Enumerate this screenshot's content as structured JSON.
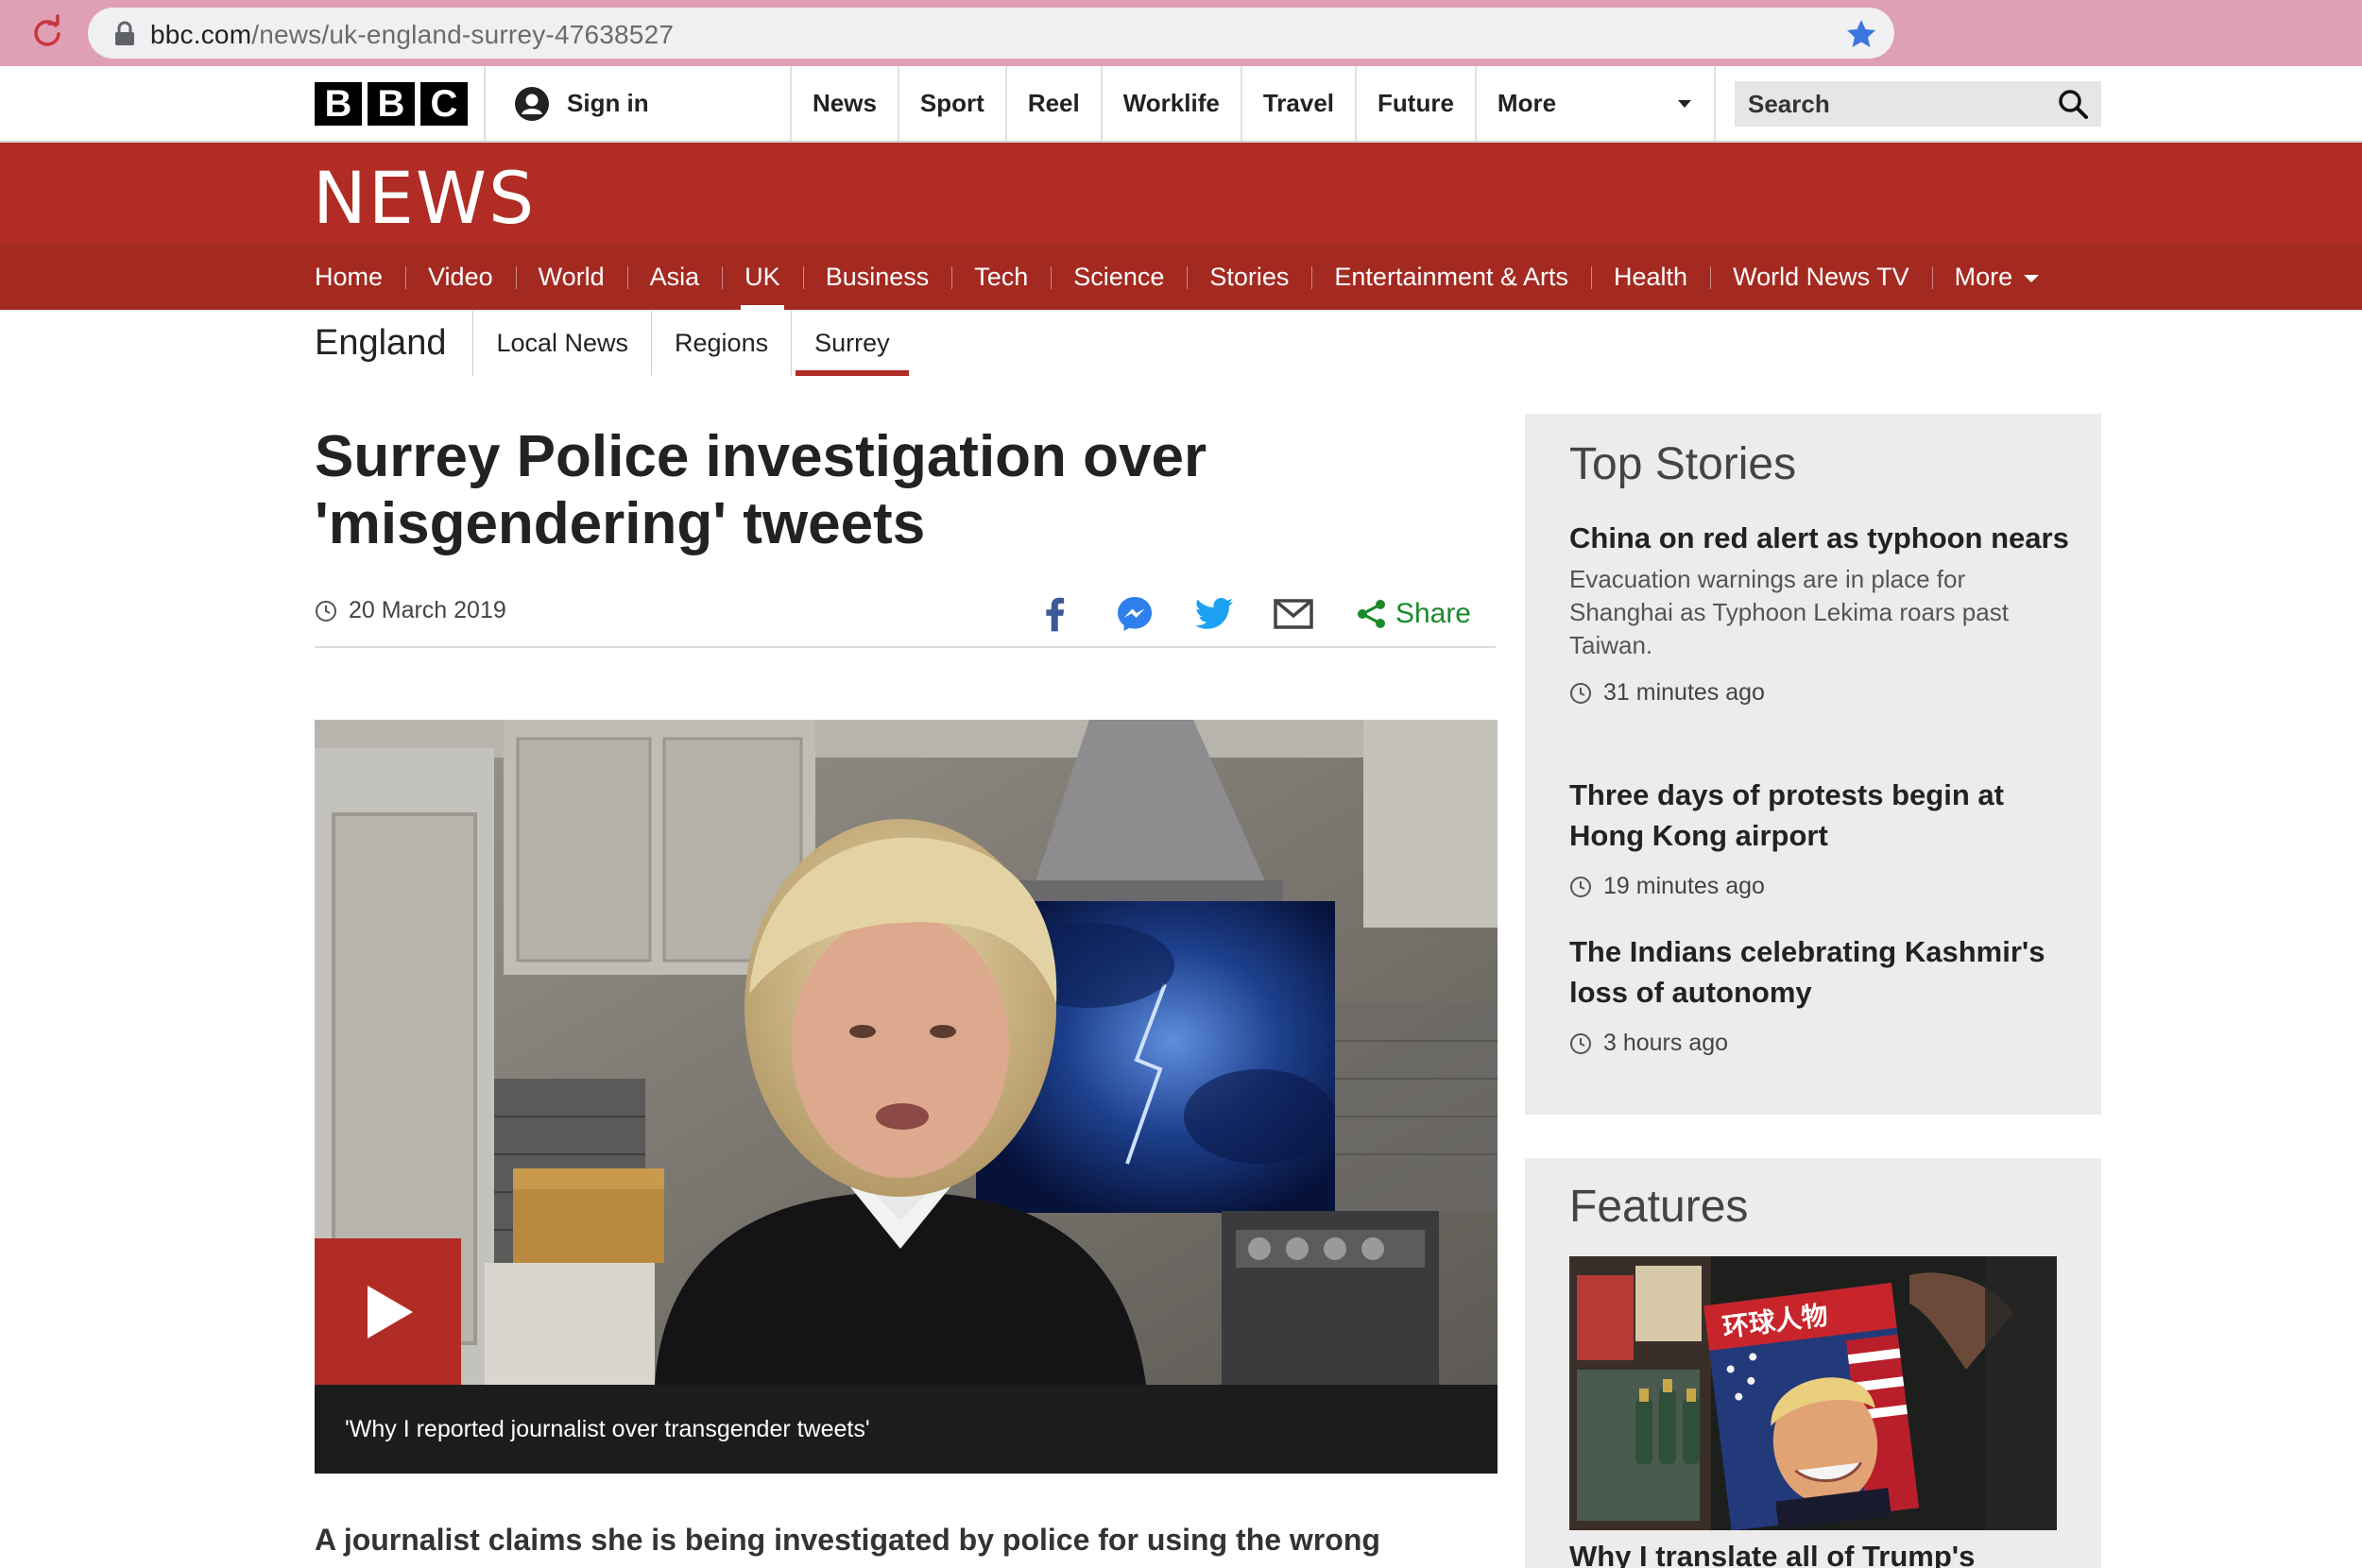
{
  "browser": {
    "url_host": "bbc.com",
    "url_path": "/news/uk-england-surrey-47638527"
  },
  "bbc_bar": {
    "logo_letters": [
      "B",
      "B",
      "C"
    ],
    "sign_in": "Sign in",
    "nav": [
      "News",
      "Sport",
      "Reel",
      "Worklife",
      "Travel",
      "Future"
    ],
    "more": "More",
    "search_placeholder": "Search"
  },
  "news_header": {
    "brand": "NEWS",
    "sections": [
      "Home",
      "Video",
      "World",
      "Asia",
      "UK",
      "Business",
      "Tech",
      "Science",
      "Stories",
      "Entertainment & Arts",
      "Health",
      "World News TV"
    ],
    "active_section": "UK",
    "more": "More"
  },
  "sub_nav": {
    "region": "England",
    "items": [
      "Local News",
      "Regions",
      "Surrey"
    ],
    "active": "Surrey"
  },
  "article": {
    "headline": "Surrey Police investigation over 'misgendering' tweets",
    "date": "20 March 2019",
    "share_label": "Share",
    "share_icons": [
      "facebook-icon",
      "messenger-icon",
      "twitter-icon",
      "email-icon",
      "share-icon"
    ],
    "video_caption": "'Why I reported journalist over transgender tweets'",
    "lede": "A journalist claims she is being investigated by police for using the wrong"
  },
  "top_stories": {
    "title": "Top Stories",
    "items": [
      {
        "headline": "China on red alert as typhoon nears",
        "summary": "Evacuation warnings are in place for Shanghai as Typhoon Lekima roars past Taiwan.",
        "time": "31 minutes ago"
      },
      {
        "headline": "Three days of protests begin at Hong Kong airport",
        "summary": "",
        "time": "19 minutes ago"
      },
      {
        "headline": "The Indians celebrating Kashmir's loss of autonomy",
        "summary": "",
        "time": "3 hours ago"
      }
    ]
  },
  "features": {
    "title": "Features",
    "magazine_cover_text": "环球人物",
    "headline": "Why I translate all of Trump's"
  },
  "colors": {
    "bbc_red": "#b12c25",
    "section_nav_red": "#a42a21",
    "share_green": "#1a8a2b",
    "chrome_pink": "#df9fb4"
  }
}
